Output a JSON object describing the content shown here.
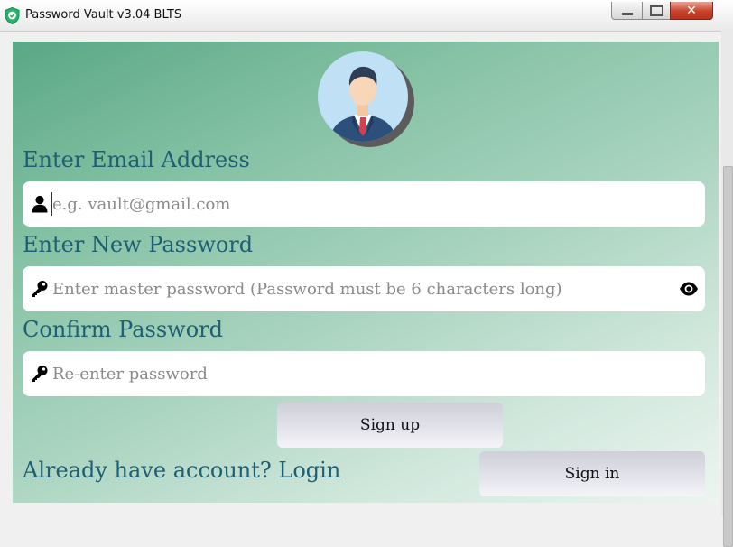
{
  "window": {
    "title": "Password Vault v3.04 BLTS",
    "icon": "shield-check-icon",
    "controls": [
      "minimize",
      "maximize",
      "close"
    ]
  },
  "avatar": {
    "icon": "businessman-avatar-icon"
  },
  "email": {
    "label": "Enter Email Address",
    "placeholder": "e.g. vault@gmail.com",
    "value": "",
    "icon": "user-icon"
  },
  "new_password": {
    "label": "Enter New Password",
    "placeholder": "Enter master password (Password must be 6 characters long)",
    "value": "",
    "icon": "key-icon",
    "toggle_icon": "eye-icon"
  },
  "confirm_password": {
    "label": "Confirm Password",
    "placeholder": "Re-enter password",
    "value": "",
    "icon": "key-icon"
  },
  "buttons": {
    "sign_up": "Sign up",
    "sign_in": "Sign in"
  },
  "login_prompt": "Already have account? Login",
  "colors": {
    "label_text": "#1f5f73",
    "panel_gradient_start": "#5aa885",
    "panel_gradient_end": "#ecf5f0",
    "button_bg": "#e4e4ec",
    "close_button": "#c8432c"
  }
}
